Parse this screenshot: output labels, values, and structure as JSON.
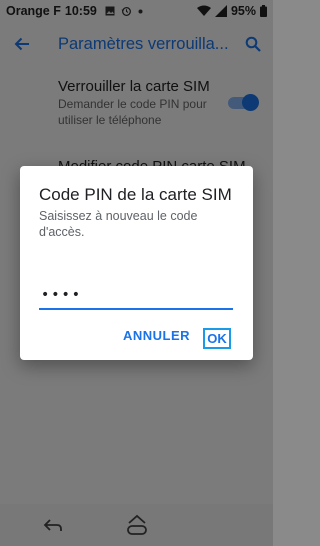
{
  "status_bar": {
    "carrier": "Orange F",
    "time": "10:59",
    "battery": "95%",
    "icons": [
      "image-icon",
      "sync-icon",
      "dot-icon",
      "wifi-icon",
      "signal-icon",
      "battery-icon"
    ]
  },
  "app_bar": {
    "title": "Paramètres verrouilla...",
    "back_icon": "arrow-back-icon",
    "search_icon": "search-icon"
  },
  "settings": {
    "lock_sim": {
      "title": "Verrouiller la carte SIM",
      "summary": "Demander le code PIN pour utiliser le téléphone",
      "enabled": true
    },
    "change_pin": {
      "title": "Modifier code PIN carte SIM"
    }
  },
  "dialog": {
    "title": "Code PIN de la carte SIM",
    "message": "Saisissez à nouveau le code d'accès.",
    "pin_value": "••••",
    "cancel_label": "ANNULER",
    "ok_label": "OK"
  },
  "nav_bar": {
    "back_icon": "nav-back-icon",
    "home_icon": "nav-home-icon"
  },
  "colors": {
    "accent": "#1a73e8",
    "focus_outline": "#1a9be8",
    "scrim": "rgba(0,0,0,0.5)"
  }
}
